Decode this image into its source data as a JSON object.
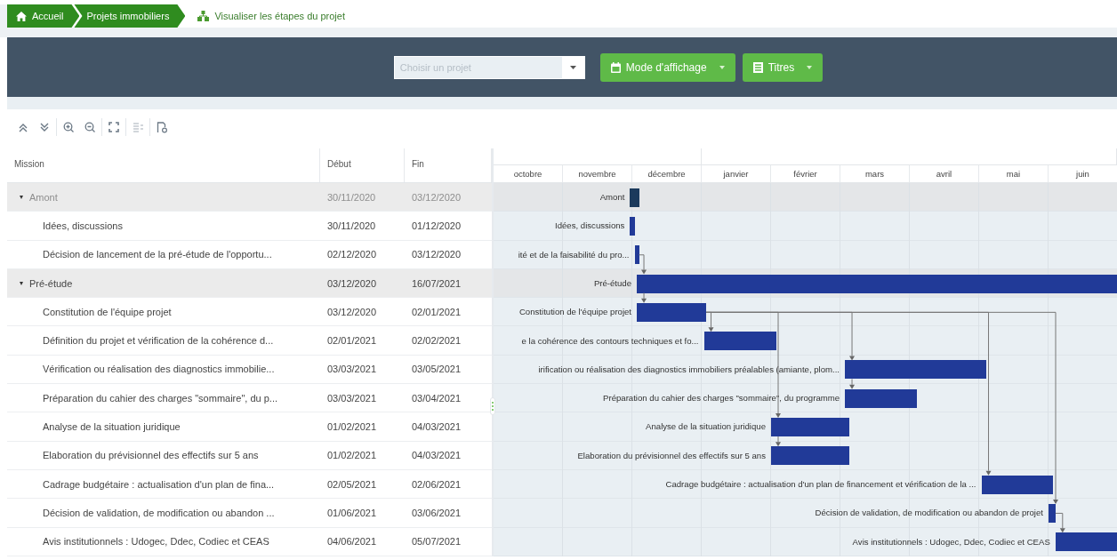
{
  "breadcrumb": [
    {
      "label": "Accueil",
      "current": false
    },
    {
      "label": "Projets immobiliers",
      "current": false
    },
    {
      "label": "Visualiser les étapes du projet",
      "current": true
    }
  ],
  "filter_bar": {
    "project_select": {
      "placeholder": "Choisir un projet"
    },
    "buttons": [
      {
        "label": "Mode d'affichage"
      },
      {
        "label": "Titres"
      }
    ]
  },
  "toolbar": [
    {
      "kind": "collapse",
      "disabled": false
    },
    {
      "kind": "expand",
      "disabled": false
    },
    {
      "kind": "zoom-in",
      "disabled": false
    },
    {
      "kind": "zoom-out",
      "disabled": false
    },
    {
      "kind": "fit",
      "disabled": false
    },
    {
      "kind": "list",
      "disabled": true
    },
    {
      "kind": "export",
      "disabled": false
    }
  ],
  "gantt": {
    "columns": [
      "Mission",
      "Début",
      "Fin"
    ],
    "months": [
      "octobre",
      "novembre",
      "décembre",
      "janvier",
      "février",
      "mars",
      "avril",
      "mai",
      "juin"
    ],
    "rows": [
      {
        "kind": "group",
        "expanded": true,
        "muted": true,
        "from_previous": false,
        "from_first_task": false,
        "mission": "Amont",
        "start": "30/11/2020",
        "end": "03/12/2020",
        "bar_label": "Amont"
      },
      {
        "kind": "task",
        "muted": false,
        "from_previous": false,
        "from_first_task": false,
        "mission": "Idées, discussions",
        "start": "30/11/2020",
        "end": "01/12/2020",
        "bar_label": "Idées, discussions"
      },
      {
        "kind": "task",
        "muted": false,
        "from_previous": false,
        "from_first_task": false,
        "mission": "Décision de lancement de la pré-étude de l'opportu...",
        "start": "02/12/2020",
        "end": "03/12/2020",
        "bar_label": "ité et de la faisabilité du pro..."
      },
      {
        "kind": "group",
        "expanded": true,
        "muted": false,
        "from_previous": true,
        "from_first_task": false,
        "mission": "Pré-étude",
        "start": "03/12/2020",
        "end": "16/07/2021",
        "bar_label": "Pré-étude"
      },
      {
        "kind": "task",
        "muted": false,
        "from_previous": true,
        "from_first_task": false,
        "mission": "Constitution de l'équipe projet",
        "start": "03/12/2020",
        "end": "02/01/2021",
        "bar_label": "Constitution de l'équipe projet"
      },
      {
        "kind": "task",
        "muted": false,
        "from_previous": true,
        "from_first_task": false,
        "mission": "Définition du projet et vérification de la cohérence d...",
        "start": "02/01/2021",
        "end": "02/02/2021",
        "bar_label": "e la cohérence des contours techniques et fo..."
      },
      {
        "kind": "task",
        "muted": false,
        "from_previous": false,
        "from_first_task": true,
        "mission": "Vérification ou réalisation des diagnostics immobilie...",
        "start": "03/03/2021",
        "end": "03/05/2021",
        "bar_label": "irification ou réalisation des diagnostics immobiliers préalables (amiante, plom..."
      },
      {
        "kind": "task",
        "muted": false,
        "from_previous": true,
        "from_first_task": false,
        "mission": "Préparation du cahier des charges \"sommaire\", du p...",
        "start": "03/03/2021",
        "end": "03/04/2021",
        "bar_label": "Préparation du cahier des charges \"sommaire\", du programme"
      },
      {
        "kind": "task",
        "muted": false,
        "from_previous": false,
        "from_first_task": true,
        "mission": "Analyse de la situation juridique",
        "start": "01/02/2021",
        "end": "04/03/2021",
        "bar_label": "Analyse de la situation juridique"
      },
      {
        "kind": "task",
        "muted": false,
        "from_previous": true,
        "from_first_task": false,
        "mission": "Elaboration du prévisionnel des effectifs sur 5 ans",
        "start": "01/02/2021",
        "end": "04/03/2021",
        "bar_label": "Elaboration du prévisionnel des effectifs sur 5 ans"
      },
      {
        "kind": "task",
        "muted": false,
        "from_previous": false,
        "from_first_task": true,
        "mission": "Cadrage budgétaire : actualisation d'un plan de fina...",
        "start": "02/05/2021",
        "end": "02/06/2021",
        "bar_label": "Cadrage budgétaire : actualisation d'un plan de financement et vérification de la ..."
      },
      {
        "kind": "task",
        "muted": false,
        "from_previous": false,
        "from_first_task": true,
        "mission": "Décision de validation, de modification ou abandon ...",
        "start": "01/06/2021",
        "end": "03/06/2021",
        "bar_label": "Décision de validation, de modification ou abandon de projet"
      },
      {
        "kind": "task",
        "muted": false,
        "from_previous": true,
        "from_first_task": false,
        "mission": "Avis institutionnels : Udogec, Ddec, Codiec et CEAS",
        "start": "04/06/2021",
        "end": "05/07/2021",
        "bar_label": "Avis institutionnels : Udogec, Ddec, Codiec et CEAS"
      }
    ]
  }
}
